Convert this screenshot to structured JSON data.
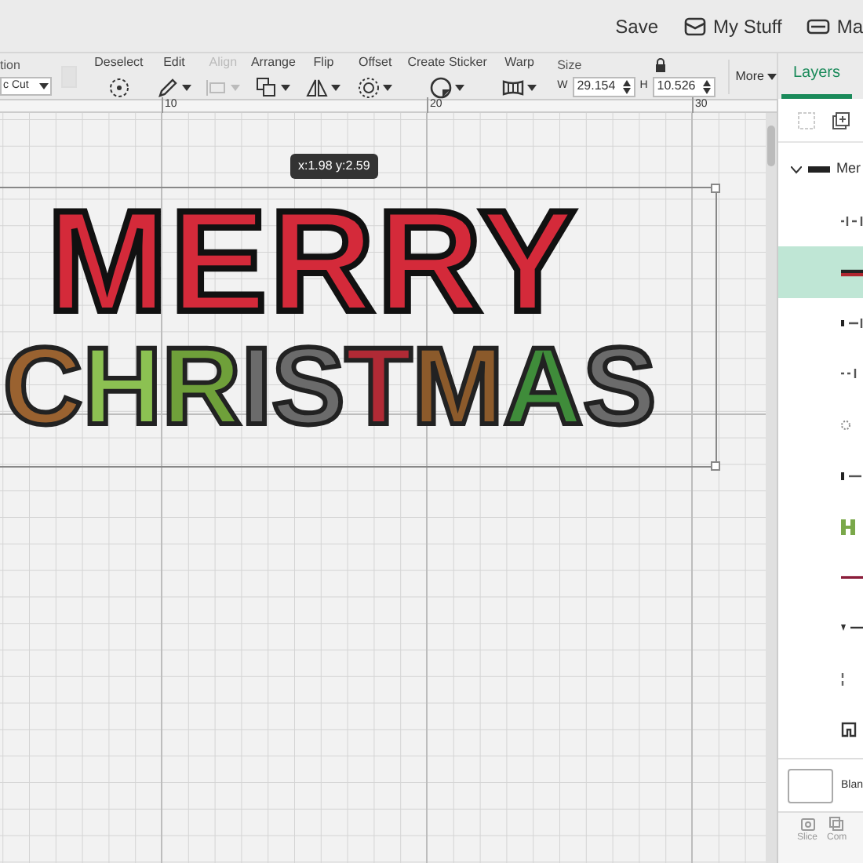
{
  "top_bar": {
    "buttons": [
      "Save",
      "My Stuff",
      "Ma"
    ]
  },
  "toolbar": {
    "operation_label": "tion",
    "operation_value": "c Cut",
    "tools": [
      {
        "label": "Deselect",
        "kind": "deselect",
        "disabled": false,
        "dropdown": false
      },
      {
        "label": "Edit",
        "kind": "edit",
        "disabled": false,
        "dropdown": true
      },
      {
        "label": "Align",
        "kind": "align",
        "disabled": true,
        "dropdown": true
      },
      {
        "label": "Arrange",
        "kind": "arrange",
        "disabled": false,
        "dropdown": true
      },
      {
        "label": "Flip",
        "kind": "flip",
        "disabled": false,
        "dropdown": true
      },
      {
        "label": "Offset",
        "kind": "offset",
        "disabled": false,
        "dropdown": true
      },
      {
        "label": "Create Sticker",
        "kind": "sticker",
        "disabled": false,
        "dropdown": true
      },
      {
        "label": "Warp",
        "kind": "warp",
        "disabled": false,
        "dropdown": true
      }
    ],
    "size": {
      "label": "Size",
      "w_label": "W",
      "w_value": "29.154",
      "h_label": "H",
      "h_value": "10.526"
    },
    "more": "More"
  },
  "ruler": {
    "ticks": [
      "10",
      "20",
      "30"
    ]
  },
  "canvas": {
    "tooltip": "x:1.98 y:2.59",
    "artwork": {
      "line_1": "MERRY",
      "line_2": "CHRISTMAS"
    }
  },
  "layers_panel": {
    "tab": "Layers",
    "group": {
      "name": "Mer",
      "expanded": true
    },
    "layers": [
      {
        "selected": false
      },
      {
        "selected": true
      },
      {
        "selected": false
      },
      {
        "selected": false
      },
      {
        "selected": false
      },
      {
        "selected": false
      },
      {
        "selected": false
      },
      {
        "selected": false
      },
      {
        "selected": false
      },
      {
        "selected": false
      },
      {
        "selected": false
      }
    ],
    "blank_canvas": "Blan",
    "bottom_buttons": [
      "Slice",
      "Com"
    ]
  }
}
